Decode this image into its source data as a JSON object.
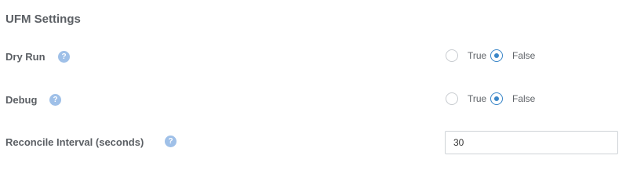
{
  "section": {
    "title": "UFM Settings"
  },
  "settings": {
    "dry_run": {
      "label": "Dry Run",
      "help_glyph": "?",
      "help_icon": "question-circle-icon",
      "options": [
        {
          "label": "True",
          "selected": false
        },
        {
          "label": "False",
          "selected": true
        }
      ]
    },
    "debug": {
      "label": "Debug",
      "help_glyph": "?",
      "help_icon": "question-circle-icon",
      "options": [
        {
          "label": "True",
          "selected": false
        },
        {
          "label": "False",
          "selected": true
        }
      ]
    },
    "reconcile_interval": {
      "label": "Reconcile Interval (seconds)",
      "help_glyph": "?",
      "help_icon": "question-circle-icon",
      "value": "30"
    }
  },
  "colors": {
    "accent": "#3a86c8",
    "help_icon_bg": "#9fc0e8",
    "label_text": "#5b5f64"
  }
}
